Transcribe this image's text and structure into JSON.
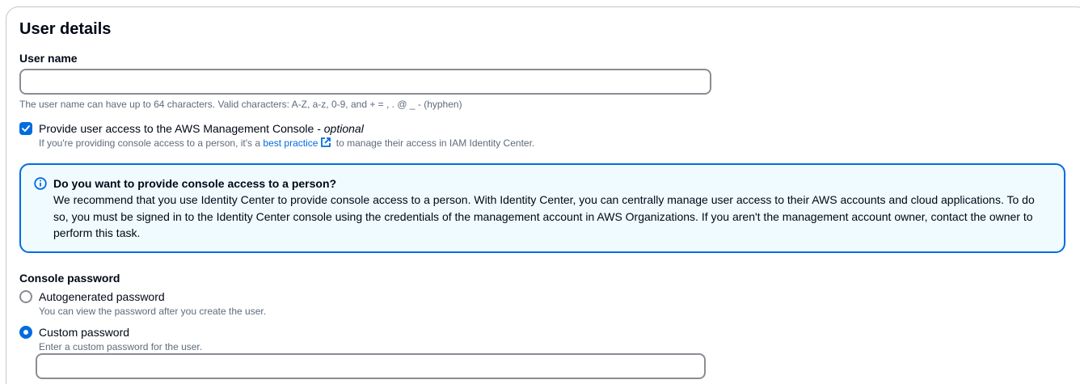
{
  "user_details": {
    "title": "User details",
    "user_name": {
      "label": "User name",
      "value": "",
      "placeholder": "",
      "hint": "The user name can have up to 64 characters. Valid characters: A-Z, a-z, 0-9, and + = , . @ _ - (hyphen)"
    },
    "console_access": {
      "checked": true,
      "label": "Provide user access to the AWS Management Console - ",
      "optional": "optional",
      "desc_prefix": "If you're providing console access to a person, it's a ",
      "desc_link": "best practice",
      "desc_suffix": " to manage their access in IAM Identity Center."
    },
    "info": {
      "title": "Do you want to provide console access to a person?",
      "body": "We recommend that you use Identity Center to provide console access to a person. With Identity Center, you can centrally manage user access to their AWS accounts and cloud applications. To do so, you must be signed in to the Identity Center console using the credentials of the management account in AWS Organizations. If you aren't the management account owner, contact the owner to perform this task."
    },
    "console_password": {
      "label": "Console password",
      "options": [
        {
          "label": "Autogenerated password",
          "desc": "You can view the password after you create the user.",
          "selected": false
        },
        {
          "label": "Custom password",
          "desc": "Enter a custom password for the user.",
          "selected": true
        }
      ],
      "custom_value": ""
    }
  },
  "colors": {
    "accent": "#006ce0",
    "info_background": "#f0fbff",
    "input_border": "#8c8c94",
    "hint_text": "#5f6b7a"
  }
}
